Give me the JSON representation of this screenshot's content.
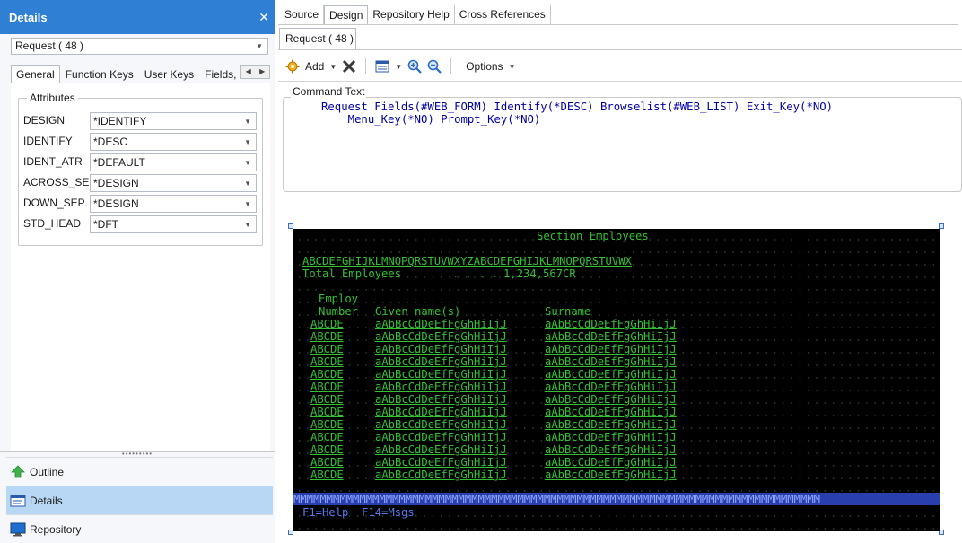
{
  "details_panel": {
    "title": "Details",
    "close_glyph": "✕",
    "request_select": "Request ( 48 )",
    "tabs": [
      "General",
      "Function Keys",
      "User Keys",
      "Fields, Gro"
    ],
    "attributes_legend": "Attributes",
    "attributes": [
      {
        "label": "DESIGN",
        "value": "*IDENTIFY"
      },
      {
        "label": "IDENTIFY",
        "value": "*DESC"
      },
      {
        "label": "IDENT_ATR",
        "value": "*DEFAULT"
      },
      {
        "label": "ACROSS_SEP",
        "value": "*DESIGN"
      },
      {
        "label": "DOWN_SEP",
        "value": "*DESIGN"
      },
      {
        "label": "STD_HEAD",
        "value": "*DFT"
      }
    ],
    "nav_items": [
      {
        "label": "Outline",
        "icon": "outline-arrow-icon",
        "active": false
      },
      {
        "label": "Details",
        "icon": "details-icon",
        "active": true
      },
      {
        "label": "Repository",
        "icon": "repository-monitor-icon",
        "active": false
      }
    ]
  },
  "editor": {
    "top_tabs": [
      "Source",
      "Design",
      "Repository Help",
      "Cross References"
    ],
    "active_top_tab": "Design",
    "doc_tab": "Request ( 48 )",
    "toolbar": {
      "add_label": "Add",
      "options_label": "Options",
      "icons": [
        "add-gear-icon",
        "delete-x-icon",
        "layout-icon",
        "zoom-in-icon",
        "zoom-out-icon"
      ]
    },
    "command_legend": "Command Text",
    "command_lines": [
      "Request Fields(#WEB_FORM) Identify(*DESC) Browselist(#WEB_LIST) Exit_Key(*NO)",
      "    Menu_Key(*NO) Prompt_Key(*NO)"
    ]
  },
  "terminal": {
    "section_title": "Section Employees",
    "alphabet_line": "ABCDEFGHIJKLMNOPQRSTUVWXYZABCDEFGHIJKLMNOPQRSTUVWX",
    "total_label": "Total Employees",
    "total_value": "1,234,567CR",
    "col_header_1a": "Employ",
    "col_header_1b": "Number",
    "col_header_2": "Given name(s)",
    "col_header_3": "Surname",
    "row_number": "ABCDE",
    "row_given": "aAbBcCdDeEfFgGhHiIjJ",
    "row_surname": "aAbBcCdDeEfFgGhHiIjJ",
    "row_count": 13,
    "m_line": "MMMMMMMMMMMMMMMMMMMMMMMMMMMMMMMMMMMMMMMMMMMMMMMMMMMMMMMMMMMMMMMMMMMMMMMMMMMMMMMM",
    "function_keys": "F1=Help  F14=Msgs"
  },
  "colors": {
    "header_blue": "#2f7fd4",
    "terminal_green": "#33c033",
    "terminal_blue": "#5a78f0",
    "nav_active": "#b8d7f4"
  }
}
